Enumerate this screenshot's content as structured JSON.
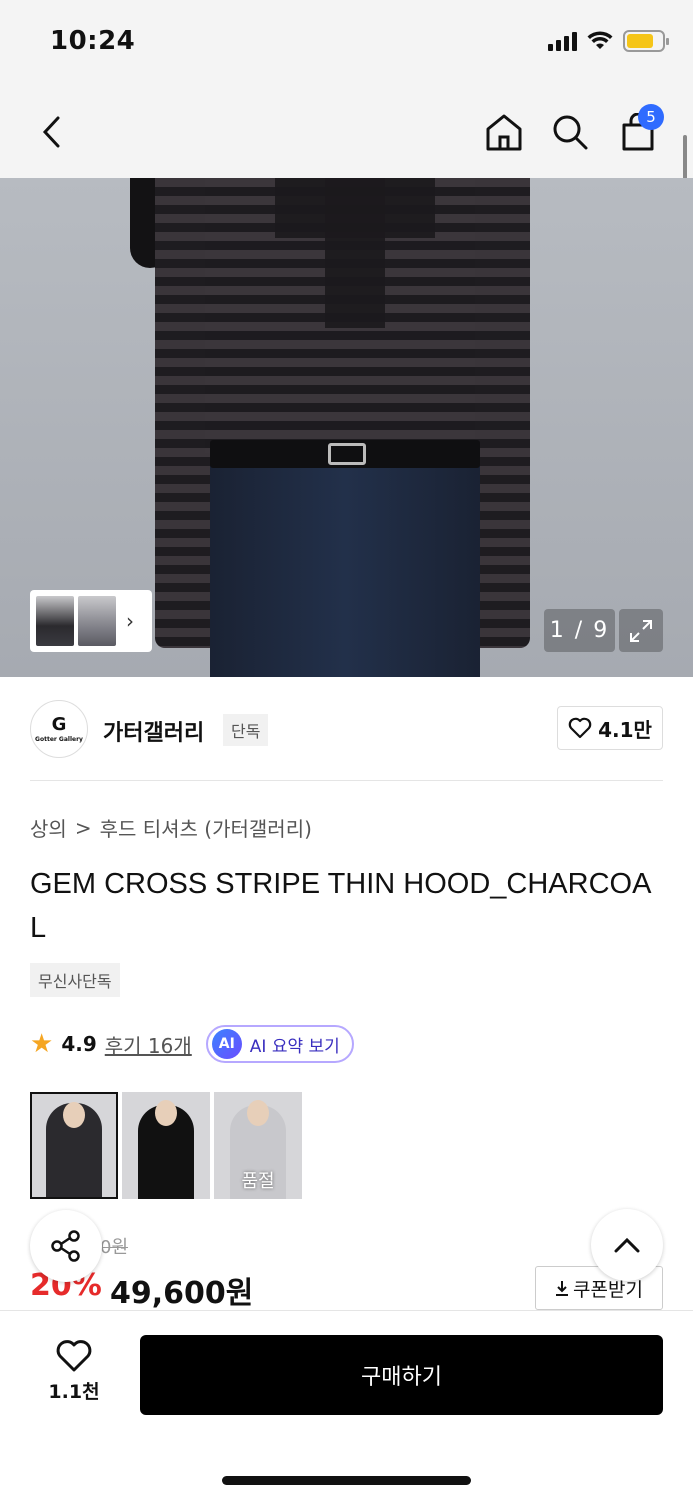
{
  "status_bar": {
    "time": "10:24"
  },
  "nav": {
    "cart_count": "5"
  },
  "gallery": {
    "counter": "1 / 9"
  },
  "brand": {
    "name": "가터갤러리",
    "tag": "단독",
    "logo_text": "Gotter Gallery",
    "likes": "4.1만"
  },
  "breadcrumb": {
    "category": "상의",
    "separator": ">",
    "subcategory": "후드 티셔츠 (가터갤러리)"
  },
  "product": {
    "title": "GEM CROSS STRIPE THIN HOOD_CHARCOAL",
    "exclusive_tag": "무신사단독",
    "rating": "4.9",
    "review_link": "후기 16개",
    "ai_badge": "AI",
    "ai_summary_label": "AI 요약 보기",
    "options": [
      {
        "sold_out": false
      },
      {
        "sold_out": false
      },
      {
        "sold_out": true,
        "label": "품절"
      }
    ]
  },
  "price": {
    "original_visible": "0원",
    "discount": "20%",
    "sale": "49,600원",
    "coupon_label": "쿠폰받기"
  },
  "bottom_bar": {
    "wish_count": "1.1천",
    "buy_label": "구매하기"
  },
  "colors": {
    "accent_blue": "#2f6bff",
    "discount_red": "#e62b2b",
    "star": "#f5a623",
    "buy_bg": "#000000"
  },
  "icons": [
    "back-chevron-icon",
    "home-icon",
    "search-icon",
    "shopping-bag-icon",
    "expand-icon",
    "heart-icon",
    "star-icon",
    "share-icon",
    "chevron-up-icon",
    "download-icon"
  ]
}
